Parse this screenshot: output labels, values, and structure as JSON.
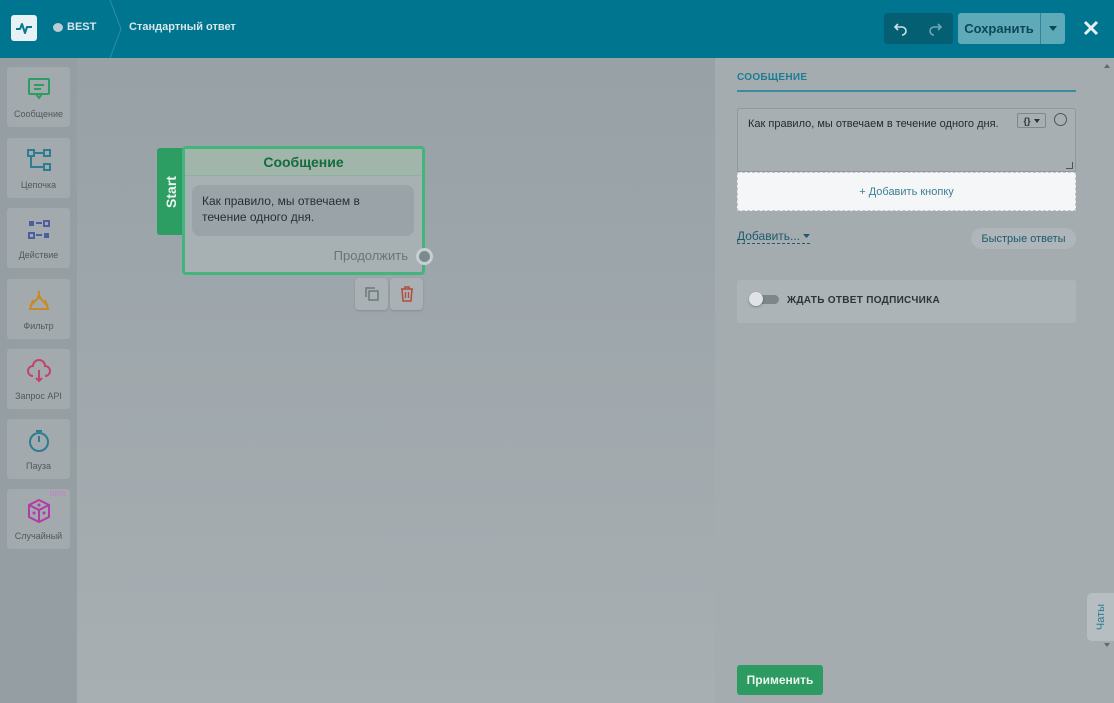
{
  "topbar": {
    "workspace": "BEST",
    "flow_title": "Стандартный ответ",
    "save_label": "Сохранить"
  },
  "tools": [
    {
      "label": "Сообщение",
      "icon": "message-icon",
      "color": "#2c9d63"
    },
    {
      "label": "Цепочка",
      "icon": "chain-icon",
      "color": "#2d7c92"
    },
    {
      "label": "Действие",
      "icon": "action-icon",
      "color": "#4d5ea0"
    },
    {
      "label": "Фильтр",
      "icon": "filter-icon",
      "color": "#c98a25"
    },
    {
      "label": "Запрос API",
      "icon": "api-request-icon",
      "color": "#c0456a"
    },
    {
      "label": "Пауза",
      "icon": "timer-icon",
      "color": "#2d7c92"
    },
    {
      "label": "Случайный",
      "icon": "dice-icon",
      "color": "#b43aa9",
      "badge": "NEW"
    }
  ],
  "node": {
    "start_label": "Start",
    "title": "Сообщение",
    "message": "Как правило, мы отвечаем в течение одного дня.",
    "continue_label": "Продолжить"
  },
  "panel": {
    "section_title": "СООБЩЕНИЕ",
    "message_text": "Как правило, мы отвечаем в течение одного дня.",
    "variables_label": "{}",
    "add_button_label": "+ Добавить кнопку",
    "add_more_label": "Добавить...",
    "quick_replies_label": "Быстрые ответы",
    "wait_reply_label": "ЖДАТЬ ОТВЕТ ПОДПИСЧИКА",
    "wait_reply_enabled": false,
    "apply_label": "Применить"
  },
  "side_tab": {
    "chats_label": "Чаты"
  },
  "colors": {
    "topbar": "#00758f",
    "accent_green": "#2d9a62",
    "accent_blue": "#1a7d94"
  }
}
